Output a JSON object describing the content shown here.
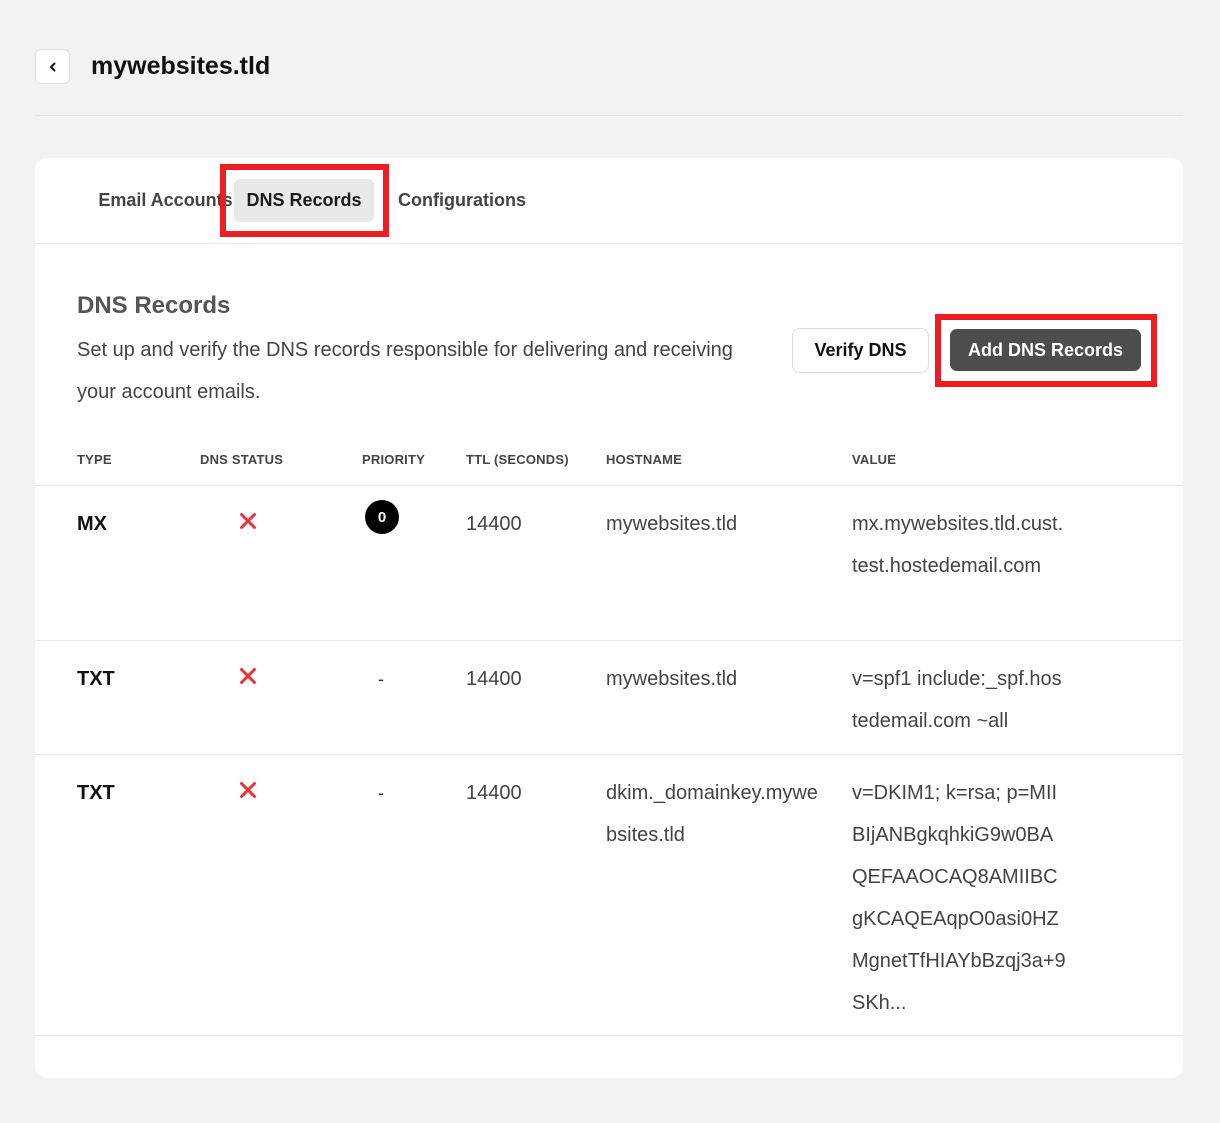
{
  "header": {
    "back_icon": "chevron-left-icon",
    "title": "mywebsites.tld"
  },
  "tabs": [
    {
      "label": "Email Accounts",
      "active": false
    },
    {
      "label": "DNS Records",
      "active": true
    },
    {
      "label": "Configurations",
      "active": false
    }
  ],
  "section": {
    "title": "DNS Records",
    "description": "Set up and verify the DNS records responsible for delivering and receiving your account emails.",
    "verify_label": "Verify DNS",
    "add_label": "Add DNS Records"
  },
  "table": {
    "headers": [
      "TYPE",
      "DNS STATUS",
      "PRIORITY",
      "TTL (SECONDS)",
      "HOSTNAME",
      "VALUE"
    ],
    "rows": [
      {
        "type": "MX",
        "status_icon": "x-icon",
        "priority": "0",
        "ttl": "14400",
        "hostname": "mywebsites.tld",
        "value": "mx.mywebsites.tld.cust.test.hostedemail.com"
      },
      {
        "type": "TXT",
        "status_icon": "x-icon",
        "priority": "-",
        "ttl": "14400",
        "hostname": "mywebsites.tld",
        "value": "v=spf1 include:_spf.hostedemail.com ~all"
      },
      {
        "type": "TXT",
        "status_icon": "x-icon",
        "priority": "-",
        "ttl": "14400",
        "hostname": "dkim._domainkey.mywebsites.tld",
        "value": "v=DKIM1; k=rsa; p=MIIBIjANBgkqhkiG9w0BAQEFAAOCAQ8AMIIBCgKCAQEAqpO0asi0HZMgnetTfHIAYbBzqj3a+9SKh..."
      }
    ]
  },
  "colors": {
    "highlight": "#ee1d23",
    "error": "#e5343a",
    "primary_button": "#4d4d4d"
  }
}
